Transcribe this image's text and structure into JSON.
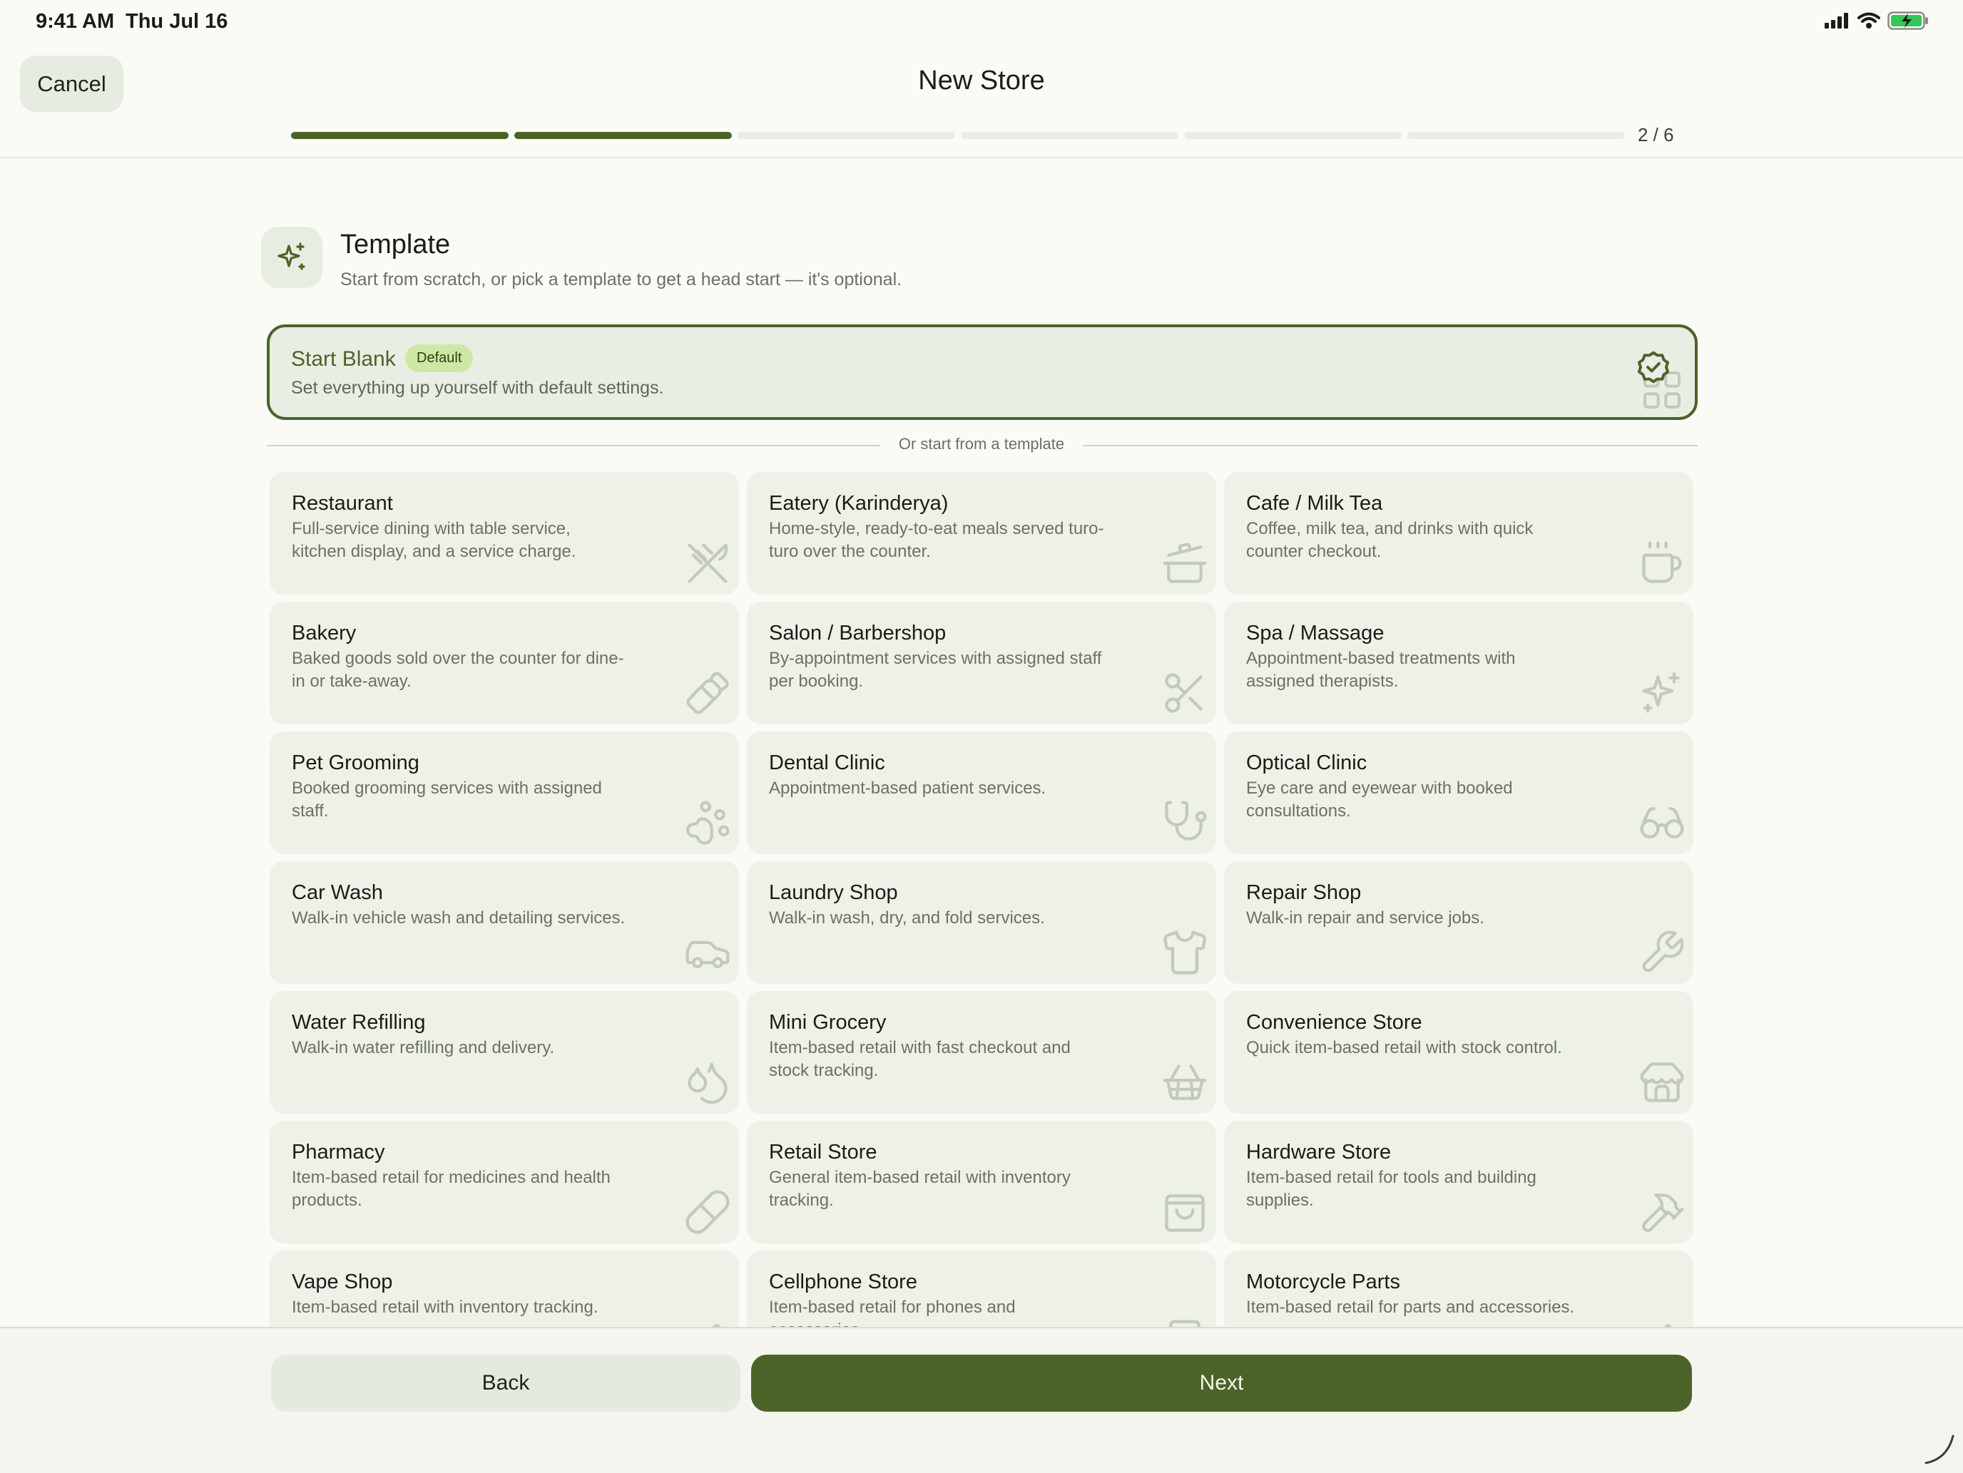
{
  "status_bar": {
    "time": "9:41 AM",
    "date": "Thu Jul 16"
  },
  "header": {
    "cancel_label": "Cancel",
    "title": "New Store",
    "progress": {
      "current": 2,
      "total": 6,
      "label": "2 / 6"
    }
  },
  "section": {
    "title": "Template",
    "subtitle": "Start from scratch, or pick a template to get a head start — it's optional.",
    "icon": "sparkles-icon"
  },
  "start_blank": {
    "title": "Start Blank",
    "badge": "Default",
    "description": "Set everything up yourself with default settings.",
    "selected": true
  },
  "divider_text": "Or start from a template",
  "templates": [
    {
      "title": "Restaurant",
      "description": "Full-service dining with table service, kitchen display, and a service charge.",
      "icon": "utensils-icon"
    },
    {
      "title": "Eatery (Karinderya)",
      "description": "Home-style, ready-to-eat meals served turo-turo over the counter.",
      "icon": "cooking-pot-icon"
    },
    {
      "title": "Cafe / Milk Tea",
      "description": "Coffee, milk tea, and drinks with quick counter checkout.",
      "icon": "coffee-cup-icon"
    },
    {
      "title": "Bakery",
      "description": "Baked goods sold over the counter for dine-in or take-away.",
      "icon": "croissant-icon"
    },
    {
      "title": "Salon / Barbershop",
      "description": "By-appointment services with assigned staff per booking.",
      "icon": "scissors-icon"
    },
    {
      "title": "Spa / Massage",
      "description": "Appointment-based treatments with assigned therapists.",
      "icon": "sparkles-icon"
    },
    {
      "title": "Pet Grooming",
      "description": "Booked grooming services with assigned staff.",
      "icon": "paw-icon"
    },
    {
      "title": "Dental Clinic",
      "description": "Appointment-based patient services.",
      "icon": "stethoscope-icon"
    },
    {
      "title": "Optical Clinic",
      "description": "Eye care and eyewear with booked consultations.",
      "icon": "glasses-icon"
    },
    {
      "title": "Car Wash",
      "description": "Walk-in vehicle wash and detailing services.",
      "icon": "car-icon"
    },
    {
      "title": "Laundry Shop",
      "description": "Walk-in wash, dry, and fold services.",
      "icon": "shirt-icon"
    },
    {
      "title": "Repair Shop",
      "description": "Walk-in repair and service jobs.",
      "icon": "wrench-icon"
    },
    {
      "title": "Water Refilling",
      "description": "Walk-in water refilling and delivery.",
      "icon": "droplets-icon"
    },
    {
      "title": "Mini Grocery",
      "description": "Item-based retail with fast checkout and stock tracking.",
      "icon": "basket-icon"
    },
    {
      "title": "Convenience Store",
      "description": "Quick item-based retail with stock control.",
      "icon": "store-icon"
    },
    {
      "title": "Pharmacy",
      "description": "Item-based retail for medicines and health products.",
      "icon": "pill-icon"
    },
    {
      "title": "Retail Store",
      "description": "General item-based retail with inventory tracking.",
      "icon": "shopping-bag-icon"
    },
    {
      "title": "Hardware Store",
      "description": "Item-based retail for tools and building supplies.",
      "icon": "hammer-icon"
    },
    {
      "title": "Vape Shop",
      "description": "Item-based retail with inventory tracking.",
      "icon": "vape-icon"
    },
    {
      "title": "Cellphone Store",
      "description": "Item-based retail for phones and accessories.",
      "icon": "smartphone-icon"
    },
    {
      "title": "Motorcycle Parts",
      "description": "Item-based retail for parts and accessories.",
      "icon": "bike-icon"
    }
  ],
  "footer": {
    "back_label": "Back",
    "next_label": "Next"
  },
  "colors": {
    "accent": "#4b6329",
    "background": "#fafbf5",
    "card": "#eef1e7",
    "badge": "#cde8a4"
  }
}
